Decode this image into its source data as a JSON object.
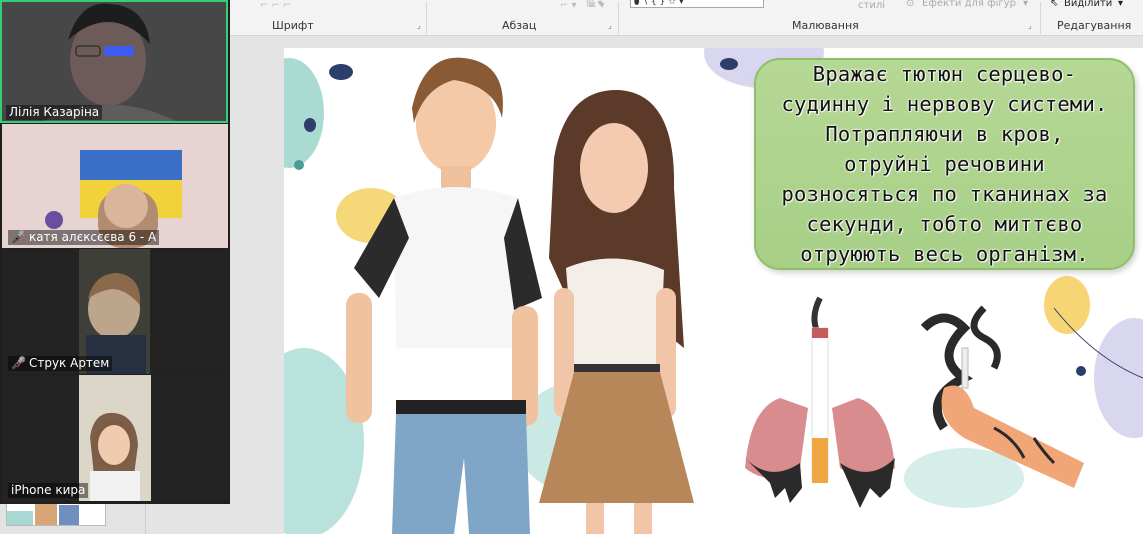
{
  "ribbon": {
    "groups": [
      {
        "label": "Шрифт"
      },
      {
        "label": "Абзац"
      },
      {
        "label": "Малювання"
      },
      {
        "label": "Редагування"
      }
    ],
    "styles_label": "стилі",
    "effects_label": "Ефекти для фігур",
    "select_label": "Виділити"
  },
  "participants": [
    {
      "name": "Лілія Казаріна",
      "muted": false,
      "active": true
    },
    {
      "name": "катя алєксєєва 6 - А",
      "muted": true,
      "active": false
    },
    {
      "name": "Струк Артем",
      "muted": true,
      "active": false
    },
    {
      "name": "iPhone кира",
      "muted": false,
      "active": false
    }
  ],
  "slide": {
    "callout_text": "Вражає тютюн серцево-\nсудинну і нервову системи.\nПотрапляючи в кров,\nотруйні речовини\nрозносяться по тканинах за\nсекунди, тобто миттєво\nотруюють весь організм."
  },
  "colors": {
    "active_speaker": "#33cf76",
    "muted_icon": "#e5393f",
    "callout_fill": "#a7cf86"
  }
}
